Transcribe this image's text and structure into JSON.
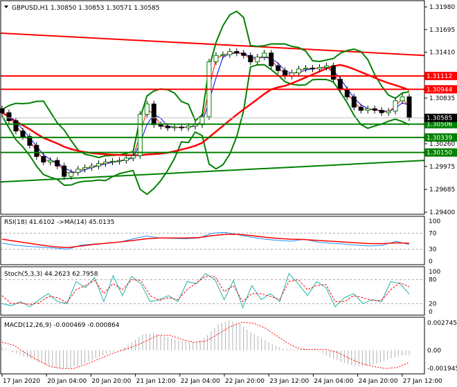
{
  "chart_data": [
    {
      "type": "candlestick",
      "title": "GBPUSD,H1",
      "symbol": "GBPUSD",
      "timeframe": "H1",
      "ohlc_label": "1.30850 1.30853 1.30571 1.30585",
      "ylim": [
        1.294,
        1.3198
      ],
      "y_ticks": [
        "1.31980",
        "1.31695",
        "1.31410",
        "1.30835",
        "1.30260",
        "1.29975",
        "1.29685",
        "1.29400"
      ],
      "close": [
        1.3065,
        1.3055,
        1.3042,
        1.3035,
        1.3024,
        1.301,
        1.3003,
        1.3005,
        1.2998,
        1.2985,
        1.299,
        1.2994,
        1.2996,
        1.2998,
        1.3001,
        1.3003,
        1.3004,
        1.3005,
        1.3008,
        1.3011,
        1.3063,
        1.3076,
        1.305,
        1.3048,
        1.3046,
        1.3047,
        1.3046,
        1.3048,
        1.305,
        1.306,
        1.3129,
        1.3137,
        1.3138,
        1.3142,
        1.314,
        1.3137,
        1.3129,
        1.3135,
        1.314,
        1.3124,
        1.3118,
        1.3111,
        1.3115,
        1.312,
        1.3121,
        1.312,
        1.3122,
        1.3124,
        1.3107,
        1.3094,
        1.3085,
        1.3072,
        1.3068,
        1.307,
        1.3068,
        1.3065,
        1.3067,
        1.308,
        1.3085,
        1.30585
      ],
      "levels": [
        {
          "value": "1.31112",
          "price": 1.31112,
          "color": "#ff0000"
        },
        {
          "value": "1.30944",
          "price": 1.30944,
          "color": "#ff0000"
        },
        {
          "value": "1.30506",
          "price": 1.30506,
          "color": "#008000"
        },
        {
          "value": "1.30339",
          "price": 1.30339,
          "color": "#008000"
        },
        {
          "value": "1.30150",
          "price": 1.3015,
          "color": "#008000"
        }
      ],
      "current_price": "1.30585",
      "trendlines": [
        {
          "color": "#ff0000",
          "from": 1.3165,
          "to": 1.3137
        },
        {
          "color": "#008000",
          "from": 1.2978,
          "to": 1.3005
        }
      ]
    },
    {
      "type": "line",
      "title": "RSI(18) 41.6102  ->MA(14) 45.0135",
      "ylim": [
        0,
        100
      ],
      "y_ticks": [
        "100",
        "70",
        "30",
        "0"
      ],
      "rsi": [
        45,
        40,
        37,
        35,
        33,
        30,
        40,
        43,
        45,
        48,
        56,
        63,
        58,
        57,
        56,
        58,
        70,
        72,
        66,
        60,
        55,
        52,
        50,
        55,
        48,
        45,
        43,
        40,
        38,
        40,
        50,
        41.6
      ],
      "ma": [
        55,
        50,
        45,
        40,
        36,
        34,
        38,
        42,
        45,
        48,
        52,
        56,
        58,
        58,
        58,
        59,
        64,
        67,
        67,
        64,
        60,
        57,
        55,
        54,
        52,
        50,
        48,
        46,
        44,
        44,
        46,
        45
      ]
    },
    {
      "type": "line",
      "title": "Stoch(5,3,3) 44.2623 62.7958",
      "ylim": [
        0,
        100
      ],
      "y_ticks": [
        "100",
        "80",
        "20",
        "0"
      ],
      "main": [
        20,
        15,
        25,
        12,
        30,
        45,
        25,
        20,
        75,
        60,
        85,
        25,
        90,
        40,
        88,
        70,
        25,
        30,
        40,
        25,
        75,
        70,
        95,
        80,
        30,
        78,
        10,
        65,
        30,
        45,
        25,
        95,
        70,
        40,
        75,
        60,
        12,
        35,
        45,
        20,
        30,
        25,
        75,
        70,
        44
      ],
      "signal": [
        40,
        20,
        22,
        18,
        22,
        38,
        35,
        22,
        55,
        65,
        78,
        45,
        70,
        55,
        80,
        78,
        40,
        28,
        35,
        30,
        55,
        72,
        88,
        88,
        50,
        65,
        25,
        45,
        45,
        38,
        30,
        75,
        80,
        55,
        65,
        68,
        25,
        25,
        40,
        35,
        28,
        28,
        55,
        72,
        62
      ]
    },
    {
      "type": "bar",
      "title": "MACD(12,26,9) -0.000469 -0.000864",
      "ylim": [
        -0.001945,
        0.002745
      ],
      "y_ticks": [
        "0.002745",
        "0.00",
        "-0.001945"
      ],
      "hist": [
        0.0003,
        -0.0002,
        -0.0006,
        -0.001,
        -0.0014,
        -0.0017,
        -0.0018,
        -0.0016,
        -0.0011,
        -0.0006,
        -0.0002,
        0.0001,
        0.0008,
        0.0016,
        0.0017,
        0.0014,
        0.0011,
        0.0009,
        0.0008,
        0.0015,
        0.0026,
        0.003,
        0.0026,
        0.0018,
        0.0012,
        0.0006,
        0.0002,
        0.0001,
        0.0002,
        0.0001,
        -0.0005,
        -0.001,
        -0.0014,
        -0.0016,
        -0.0015,
        -0.0012,
        -0.0008,
        -0.0005
      ],
      "signal": [
        0.0008,
        0.0005,
        -0.0003,
        -0.001,
        -0.0016,
        -0.0018,
        -0.0018,
        -0.0014,
        -0.0009,
        -0.0004,
        0.0,
        0.0004,
        0.0009,
        0.0015,
        0.0015,
        0.0011,
        0.0008,
        0.0009,
        0.0016,
        0.0023,
        0.0028,
        0.0027,
        0.0022,
        0.0014,
        0.0006,
        0.0001,
        0.0001,
        0.0001,
        -0.0002,
        -0.0008,
        -0.0013,
        -0.0016,
        -0.0018,
        -0.0017,
        -0.0012
      ]
    },
    {
      "type": "axis",
      "x_ticks": [
        "17 Jan 2020",
        "20 Jan 04:00",
        "20 Jan 20:00",
        "21 Jan 12:00",
        "22 Jan 04:00",
        "22 Jan 20:00",
        "23 Jan 12:00",
        "24 Jan 04:00",
        "24 Jan 20:00",
        "27 Jan 12:00"
      ]
    }
  ]
}
